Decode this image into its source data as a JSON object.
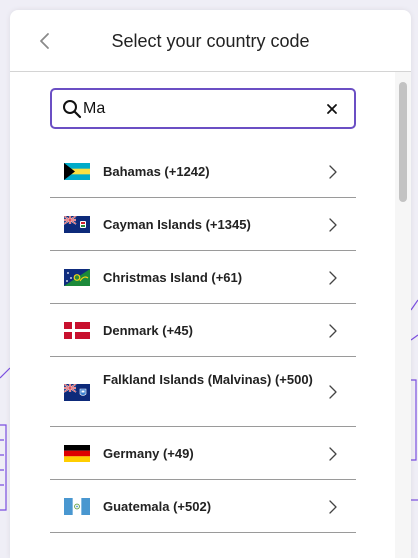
{
  "header": {
    "title": "Select your country code"
  },
  "search": {
    "value": "Ma"
  },
  "countries": [
    {
      "name": "Bahamas (+1242)",
      "flag": "bahamas-flag"
    },
    {
      "name": "Cayman Islands (+1345)",
      "flag": "cayman-islands-flag"
    },
    {
      "name": "Christmas Island (+61)",
      "flag": "christmas-island-flag"
    },
    {
      "name": "Denmark (+45)",
      "flag": "denmark-flag"
    },
    {
      "name": "Falkland Islands (Malvinas) (+500)",
      "flag": "falkland-islands-flag"
    },
    {
      "name": "Germany (+49)",
      "flag": "germany-flag"
    },
    {
      "name": "Guatemala (+502)",
      "flag": "guatemala-flag"
    }
  ],
  "colors": {
    "accent": "#6b4fc4",
    "background": "#efeef6",
    "background_lines": "#7b4fe0"
  }
}
